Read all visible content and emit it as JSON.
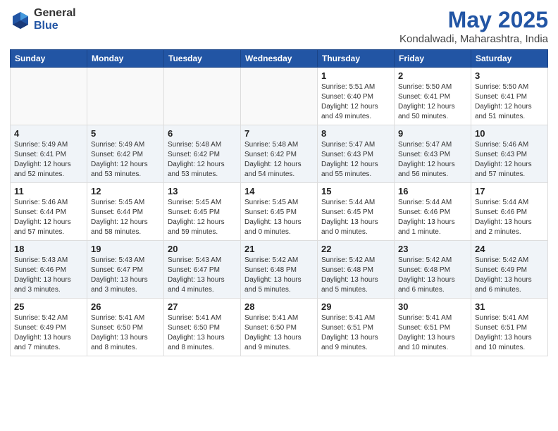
{
  "logo": {
    "general": "General",
    "blue": "Blue"
  },
  "title": "May 2025",
  "subtitle": "Kondalwadi, Maharashtra, India",
  "days_of_week": [
    "Sunday",
    "Monday",
    "Tuesday",
    "Wednesday",
    "Thursday",
    "Friday",
    "Saturday"
  ],
  "weeks": [
    [
      {
        "day": "",
        "info": "",
        "empty": true
      },
      {
        "day": "",
        "info": "",
        "empty": true
      },
      {
        "day": "",
        "info": "",
        "empty": true
      },
      {
        "day": "",
        "info": "",
        "empty": true
      },
      {
        "day": "1",
        "info": "Sunrise: 5:51 AM\nSunset: 6:40 PM\nDaylight: 12 hours\nand 49 minutes."
      },
      {
        "day": "2",
        "info": "Sunrise: 5:50 AM\nSunset: 6:41 PM\nDaylight: 12 hours\nand 50 minutes."
      },
      {
        "day": "3",
        "info": "Sunrise: 5:50 AM\nSunset: 6:41 PM\nDaylight: 12 hours\nand 51 minutes."
      }
    ],
    [
      {
        "day": "4",
        "info": "Sunrise: 5:49 AM\nSunset: 6:41 PM\nDaylight: 12 hours\nand 52 minutes."
      },
      {
        "day": "5",
        "info": "Sunrise: 5:49 AM\nSunset: 6:42 PM\nDaylight: 12 hours\nand 53 minutes."
      },
      {
        "day": "6",
        "info": "Sunrise: 5:48 AM\nSunset: 6:42 PM\nDaylight: 12 hours\nand 53 minutes."
      },
      {
        "day": "7",
        "info": "Sunrise: 5:48 AM\nSunset: 6:42 PM\nDaylight: 12 hours\nand 54 minutes."
      },
      {
        "day": "8",
        "info": "Sunrise: 5:47 AM\nSunset: 6:43 PM\nDaylight: 12 hours\nand 55 minutes."
      },
      {
        "day": "9",
        "info": "Sunrise: 5:47 AM\nSunset: 6:43 PM\nDaylight: 12 hours\nand 56 minutes."
      },
      {
        "day": "10",
        "info": "Sunrise: 5:46 AM\nSunset: 6:43 PM\nDaylight: 12 hours\nand 57 minutes."
      }
    ],
    [
      {
        "day": "11",
        "info": "Sunrise: 5:46 AM\nSunset: 6:44 PM\nDaylight: 12 hours\nand 57 minutes."
      },
      {
        "day": "12",
        "info": "Sunrise: 5:45 AM\nSunset: 6:44 PM\nDaylight: 12 hours\nand 58 minutes."
      },
      {
        "day": "13",
        "info": "Sunrise: 5:45 AM\nSunset: 6:45 PM\nDaylight: 12 hours\nand 59 minutes."
      },
      {
        "day": "14",
        "info": "Sunrise: 5:45 AM\nSunset: 6:45 PM\nDaylight: 13 hours\nand 0 minutes."
      },
      {
        "day": "15",
        "info": "Sunrise: 5:44 AM\nSunset: 6:45 PM\nDaylight: 13 hours\nand 0 minutes."
      },
      {
        "day": "16",
        "info": "Sunrise: 5:44 AM\nSunset: 6:46 PM\nDaylight: 13 hours\nand 1 minute."
      },
      {
        "day": "17",
        "info": "Sunrise: 5:44 AM\nSunset: 6:46 PM\nDaylight: 13 hours\nand 2 minutes."
      }
    ],
    [
      {
        "day": "18",
        "info": "Sunrise: 5:43 AM\nSunset: 6:46 PM\nDaylight: 13 hours\nand 3 minutes."
      },
      {
        "day": "19",
        "info": "Sunrise: 5:43 AM\nSunset: 6:47 PM\nDaylight: 13 hours\nand 3 minutes."
      },
      {
        "day": "20",
        "info": "Sunrise: 5:43 AM\nSunset: 6:47 PM\nDaylight: 13 hours\nand 4 minutes."
      },
      {
        "day": "21",
        "info": "Sunrise: 5:42 AM\nSunset: 6:48 PM\nDaylight: 13 hours\nand 5 minutes."
      },
      {
        "day": "22",
        "info": "Sunrise: 5:42 AM\nSunset: 6:48 PM\nDaylight: 13 hours\nand 5 minutes."
      },
      {
        "day": "23",
        "info": "Sunrise: 5:42 AM\nSunset: 6:48 PM\nDaylight: 13 hours\nand 6 minutes."
      },
      {
        "day": "24",
        "info": "Sunrise: 5:42 AM\nSunset: 6:49 PM\nDaylight: 13 hours\nand 6 minutes."
      }
    ],
    [
      {
        "day": "25",
        "info": "Sunrise: 5:42 AM\nSunset: 6:49 PM\nDaylight: 13 hours\nand 7 minutes."
      },
      {
        "day": "26",
        "info": "Sunrise: 5:41 AM\nSunset: 6:50 PM\nDaylight: 13 hours\nand 8 minutes."
      },
      {
        "day": "27",
        "info": "Sunrise: 5:41 AM\nSunset: 6:50 PM\nDaylight: 13 hours\nand 8 minutes."
      },
      {
        "day": "28",
        "info": "Sunrise: 5:41 AM\nSunset: 6:50 PM\nDaylight: 13 hours\nand 9 minutes."
      },
      {
        "day": "29",
        "info": "Sunrise: 5:41 AM\nSunset: 6:51 PM\nDaylight: 13 hours\nand 9 minutes."
      },
      {
        "day": "30",
        "info": "Sunrise: 5:41 AM\nSunset: 6:51 PM\nDaylight: 13 hours\nand 10 minutes."
      },
      {
        "day": "31",
        "info": "Sunrise: 5:41 AM\nSunset: 6:51 PM\nDaylight: 13 hours\nand 10 minutes."
      }
    ]
  ]
}
